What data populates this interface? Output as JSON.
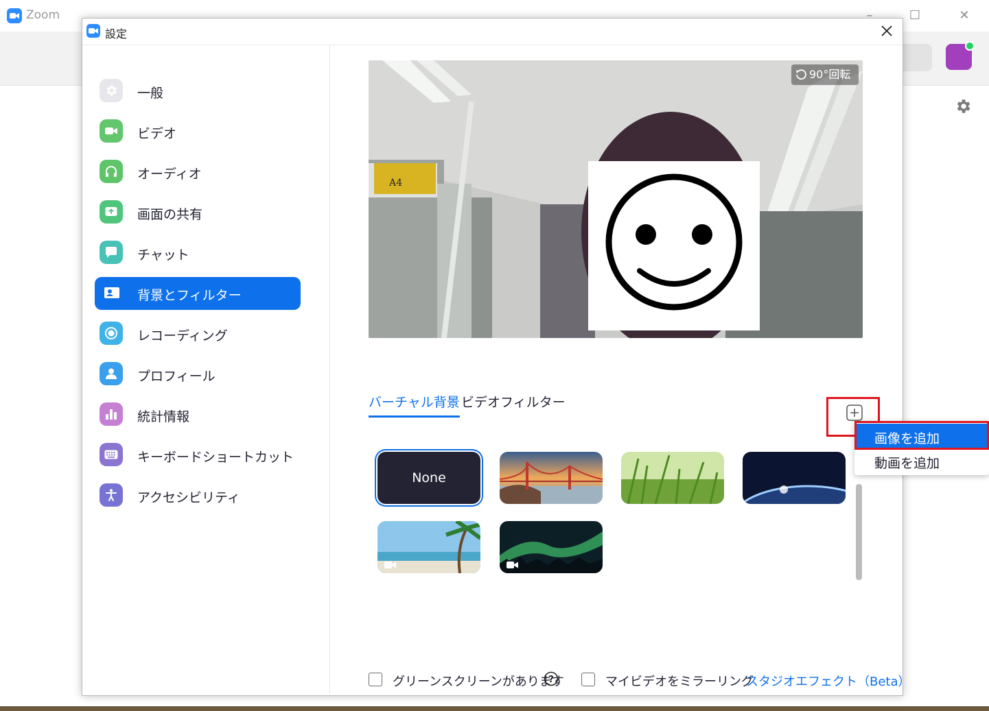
{
  "main_window": {
    "title": "Zoom",
    "brand_color": "#2D8CFF"
  },
  "dialog": {
    "title": "設定",
    "close_icon": "close-icon"
  },
  "sidebar": {
    "active_color": "#0E71EB",
    "items": [
      {
        "label": "一般",
        "icon": "gear-icon",
        "color": "#e9e9ee"
      },
      {
        "label": "ビデオ",
        "icon": "video-camera-icon",
        "color": "#63c66d"
      },
      {
        "label": "オーディオ",
        "icon": "headphones-icon",
        "color": "#5fc46a"
      },
      {
        "label": "画面の共有",
        "icon": "share-screen-icon",
        "color": "#50c57c"
      },
      {
        "label": "チャット",
        "icon": "chat-bubble-icon",
        "color": "#48c1b7"
      },
      {
        "label": "背景とフィルター",
        "icon": "background-portrait-icon",
        "color": "#ffffff",
        "active": true
      },
      {
        "label": "レコーディング",
        "icon": "record-icon",
        "color": "#3fb3e8"
      },
      {
        "label": "プロフィール",
        "icon": "person-icon",
        "color": "#3a9fed"
      },
      {
        "label": "統計情報",
        "icon": "bar-chart-icon",
        "color": "#c57fd3"
      },
      {
        "label": "キーボードショートカット",
        "icon": "keyboard-icon",
        "color": "#8a75d0"
      },
      {
        "label": "アクセシビリティ",
        "icon": "accessibility-icon",
        "color": "#7673d4"
      }
    ]
  },
  "preview": {
    "rotate_label": "90°回転",
    "rotate_icon": "rotate-icon"
  },
  "tabs": [
    {
      "label": "バーチャル背景",
      "active": true
    },
    {
      "label": "ビデオフィルター",
      "active": false
    }
  ],
  "add_button": {
    "icon": "plus-box-icon"
  },
  "backgrounds": [
    {
      "name": "none",
      "label": "None",
      "selected": true
    },
    {
      "name": "golden-gate-bridge",
      "video": false
    },
    {
      "name": "grass",
      "video": false
    },
    {
      "name": "earth-from-space",
      "video": false
    },
    {
      "name": "beach-palm",
      "video": true
    },
    {
      "name": "aurora",
      "video": true
    }
  ],
  "bottom": {
    "green_screen_label": "グリーンスクリーンがあります",
    "mirror_label": "マイビデオをミラーリング",
    "studio_effects_label": "スタジオエフェクト（Beta）",
    "green_screen_checked": false,
    "mirror_checked": false
  },
  "add_menu": {
    "items": [
      {
        "label": "画像を追加",
        "highlighted": true
      },
      {
        "label": "動画を追加",
        "highlighted": false
      }
    ]
  },
  "highlight_color": "#e0141e"
}
